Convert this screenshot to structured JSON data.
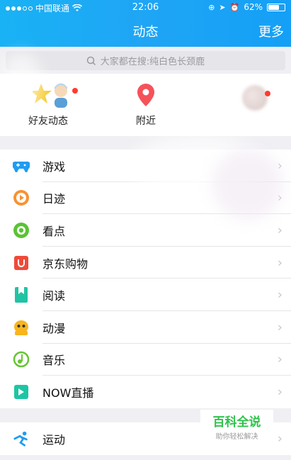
{
  "status": {
    "carrier": "中国联通",
    "time": "22:06",
    "battery": "62%",
    "battery_fraction": 0.62,
    "icons": [
      "wifi-icon",
      "lock-rotation-icon",
      "location-icon",
      "alarm-icon",
      "battery-icon"
    ]
  },
  "nav": {
    "title": "动态",
    "more": "更多"
  },
  "search": {
    "placeholder": "大家都在搜:纯白色长颈鹿",
    "icon": "search-icon"
  },
  "quick": [
    {
      "label": "好友动态",
      "icon": "friends-feed-icon",
      "badge": true
    },
    {
      "label": "附近",
      "icon": "location-pin-icon",
      "badge": false
    },
    {
      "label": "",
      "icon": "avatar-icon",
      "badge": true
    }
  ],
  "list1": [
    {
      "label": "游戏",
      "icon": "gamepad-icon",
      "color": "#1e9df2"
    },
    {
      "label": "日迹",
      "icon": "play-circle-icon",
      "color": "#f79233"
    },
    {
      "label": "看点",
      "icon": "eye-icon",
      "color": "#5ac334"
    },
    {
      "label": "京东购物",
      "icon": "jd-bag-icon",
      "color": "#ef4a3a"
    },
    {
      "label": "阅读",
      "icon": "book-icon",
      "color": "#22c3a4"
    },
    {
      "label": "动漫",
      "icon": "penguin-icon",
      "color": "#f7b51e"
    },
    {
      "label": "音乐",
      "icon": "music-note-icon",
      "color": "#67c532"
    },
    {
      "label": "NOW直播",
      "icon": "now-live-icon",
      "color": "#1cc6a3"
    }
  ],
  "list2": [
    {
      "label": "运动",
      "icon": "running-icon",
      "color": "#1e9df2"
    }
  ],
  "watermark": {
    "title": "百科全说",
    "subtitle": "助你轻松解决"
  }
}
